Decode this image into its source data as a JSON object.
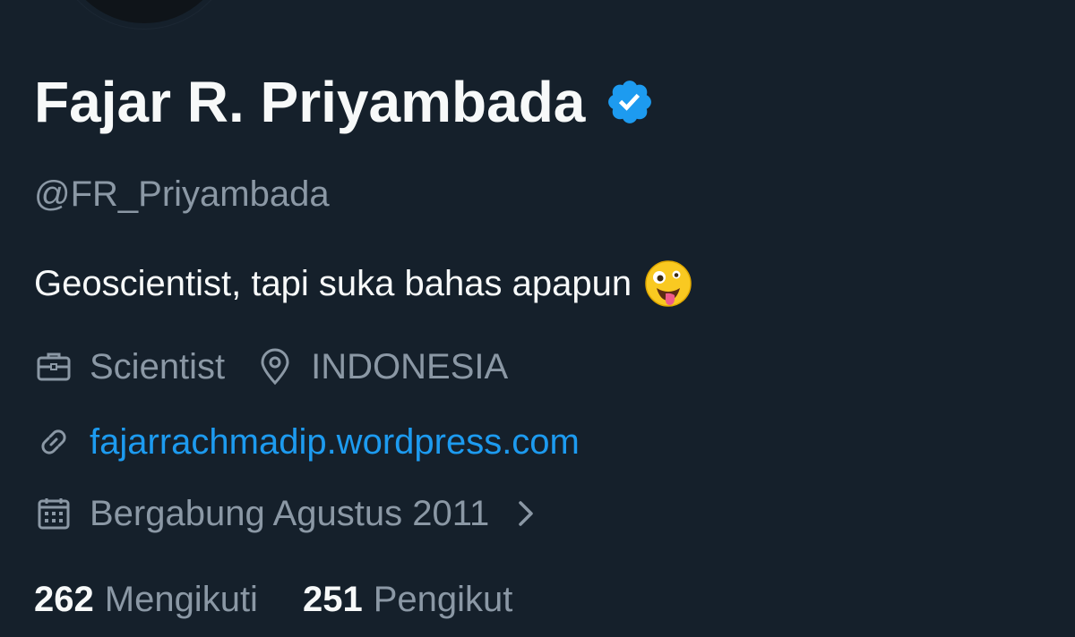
{
  "profile": {
    "display_name": "Fajar R. Priyambada",
    "handle": "@FR_Priyambada",
    "verified_icon": "verified-badge-icon",
    "bio": "Geoscientist, tapi suka bahas apapun",
    "bio_emoji": "zany-face-emoji"
  },
  "meta": {
    "profession": "Scientist",
    "profession_icon": "briefcase-icon",
    "location": "INDONESIA",
    "location_icon": "location-pin-icon",
    "website": "fajarrachmadip.wordpress.com",
    "website_icon": "link-icon",
    "joined": "Bergabung Agustus 2011",
    "joined_icon": "calendar-icon"
  },
  "stats": {
    "following_count": "262",
    "following_label": "Mengikuti",
    "followers_count": "251",
    "followers_label": "Pengikut"
  },
  "colors": {
    "background": "#15202b",
    "text_primary": "#f7f9f9",
    "text_secondary": "#8b98a5",
    "accent": "#1d9bf0"
  }
}
